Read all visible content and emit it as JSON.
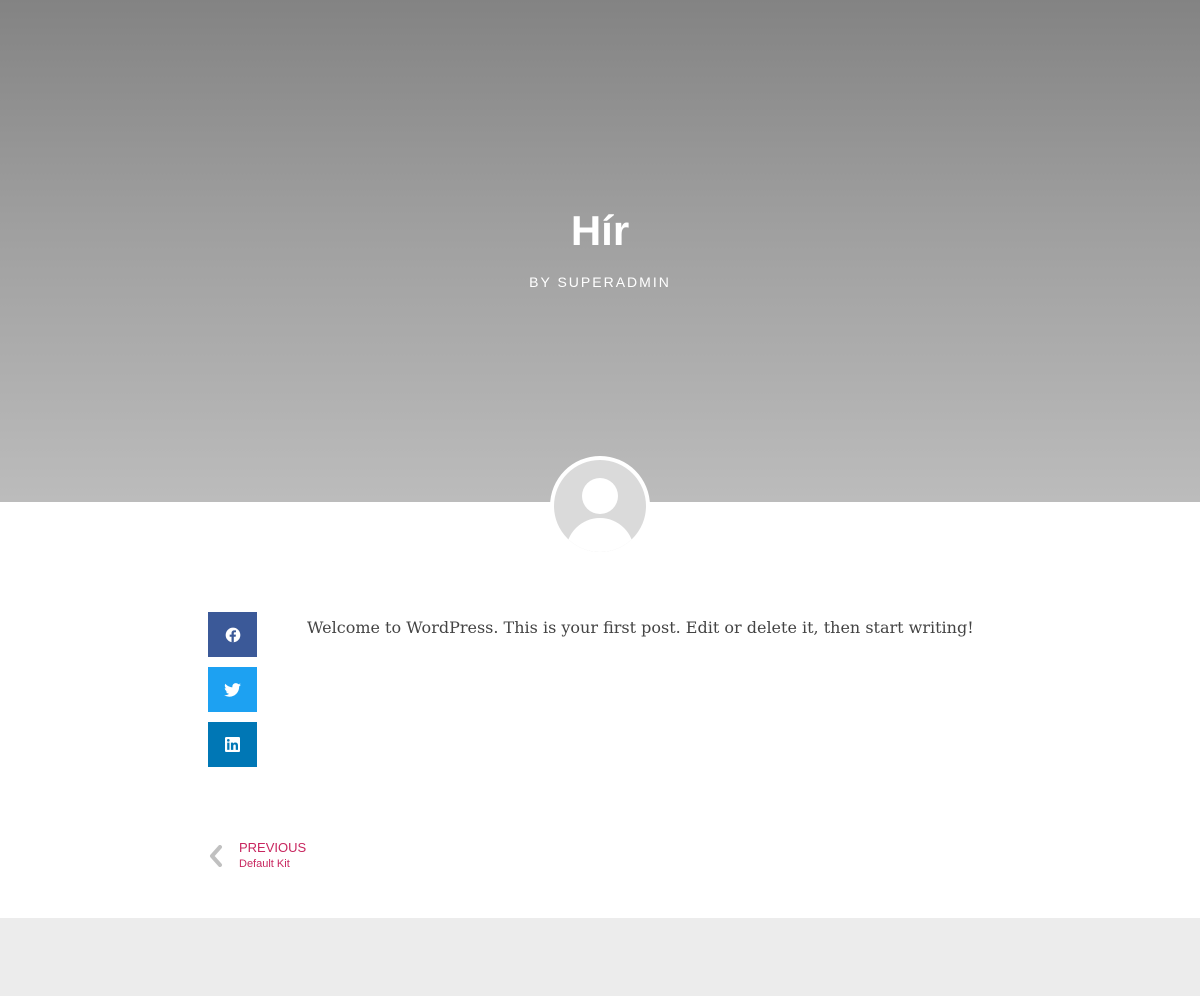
{
  "hero": {
    "title": "Hír",
    "byline": "BY SUPERADMIN",
    "gradient_top": "#838383",
    "gradient_bottom": "#bcbcbc"
  },
  "author": {
    "avatar_icon": "default-avatar-icon"
  },
  "share": {
    "buttons": [
      {
        "network": "facebook",
        "icon": "facebook-icon",
        "color": "#3b5998"
      },
      {
        "network": "twitter",
        "icon": "twitter-icon",
        "color": "#1da1f2"
      },
      {
        "network": "linkedin",
        "icon": "linkedin-icon",
        "color": "#0077b5"
      }
    ]
  },
  "post": {
    "content": "Welcome to WordPress. This is your first post. Edit or delete it, then start writing!"
  },
  "navigation": {
    "previous_label": "PREVIOUS",
    "previous_title": "Default Kit",
    "accent_color": "#c8265f",
    "arrow_icon": "chevron-left-icon"
  },
  "footer": {
    "background": "#ececec"
  }
}
